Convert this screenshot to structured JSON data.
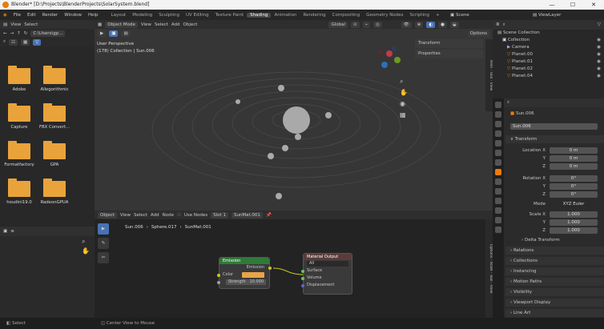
{
  "window": {
    "title": "Blender* [D:\\Projects\\BlenderProjects\\SolarSystem.blend]",
    "minimize": "—",
    "maximize": "☐",
    "close": "✕"
  },
  "menu": [
    "File",
    "Edit",
    "Render",
    "Window",
    "Help"
  ],
  "workspaces": [
    "Layout",
    "Modeling",
    "Sculpting",
    "UV Editing",
    "Texture Paint",
    "Shading",
    "Animation",
    "Rendering",
    "Compositing",
    "Geometry Nodes",
    "Scripting",
    "+"
  ],
  "scene": "Scene",
  "viewlayer": "ViewLayer",
  "filebrowser": {
    "view": "View",
    "select": "Select",
    "path": "C:\\Users\\gp...",
    "folders": [
      "Adobe",
      "Allegorithmic",
      "Capture",
      "FBX Convert...",
      "Formatfactory",
      "GPA",
      "houdini19.0",
      "RadeonGPUA"
    ]
  },
  "viewport": {
    "mode": "Object Mode",
    "menus": [
      "View",
      "Select",
      "Add",
      "Object"
    ],
    "orient": "Global",
    "label1": "User Perspective",
    "label2": "(178) Collection | Sun.006",
    "options": "Options",
    "panels": [
      "Transform",
      "Properties"
    ],
    "tabs": [
      "Item",
      "Tool",
      "View"
    ]
  },
  "node_editor": {
    "object": "Object",
    "menus": [
      "View",
      "Select",
      "Add",
      "Node"
    ],
    "use_nodes": "Use Nodes",
    "slot": "Slot 1",
    "material": "SunMat.001",
    "breadcrumb": [
      "Sun.006",
      "Sphere.017",
      "SunMat.001"
    ],
    "emission": {
      "title": "Emission",
      "out": "Emission",
      "color": "Color",
      "strength": "Strength",
      "strength_val": "10.000"
    },
    "output": {
      "title": "Material Output",
      "target": "All",
      "inputs": [
        "Surface",
        "Volume",
        "Displacement"
      ]
    },
    "side_tabs": [
      "Options",
      "Node",
      "Tool",
      "View"
    ]
  },
  "outliner": {
    "items": [
      "Scene Collection",
      "Collection",
      "Camera",
      "Planet.00",
      "Planet.01",
      "Planet.02",
      "Planet.04"
    ]
  },
  "properties": {
    "object": "Sun.006",
    "object2": "Sun.006",
    "transform": "Transform",
    "loc": [
      "Location X",
      "Y",
      "Z"
    ],
    "loc_val": [
      "0 m",
      "0 m",
      "0 m"
    ],
    "rot": [
      "Rotation X",
      "Y",
      "Z"
    ],
    "rot_val": [
      "0°",
      "0°",
      "0°"
    ],
    "mode_label": "Mode",
    "mode": "XYZ Euler",
    "scale": [
      "Scale X",
      "Y",
      "Z"
    ],
    "scale_val": [
      "1.000",
      "1.000",
      "1.000"
    ],
    "sections": [
      "Delta Transform",
      "Relations",
      "Collections",
      "Instancing",
      "Motion Paths",
      "Visibility",
      "Viewport Display",
      "Line Art"
    ]
  },
  "status": [
    "Select",
    "Center View to Mouse"
  ]
}
